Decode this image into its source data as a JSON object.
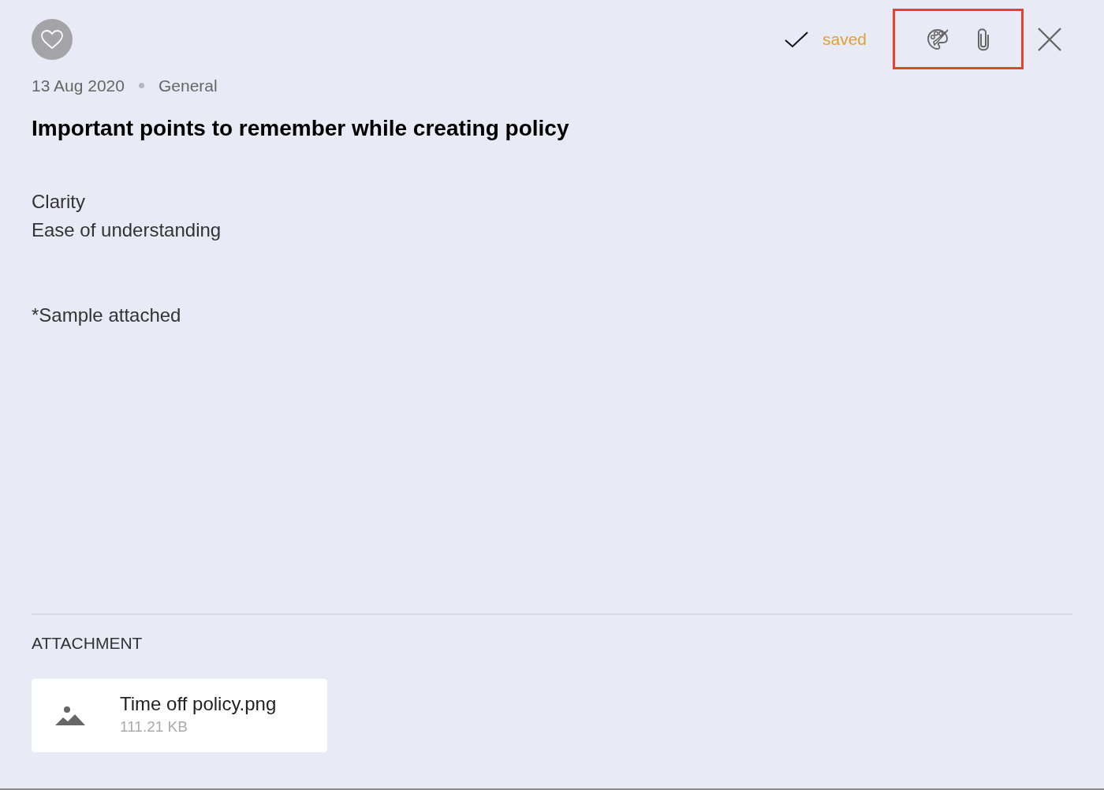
{
  "note": {
    "favorite": false,
    "date": "13 Aug 2020",
    "category": "General",
    "title": "Important points to remember while creating policy",
    "body_blocks": [
      [
        "Clarity",
        "Ease of understanding"
      ],
      [
        "*Sample attached"
      ]
    ]
  },
  "status": {
    "text": "saved",
    "saved": true
  },
  "toolbar": {
    "highlighted": true
  },
  "attachments": {
    "heading": "ATTACHMENT",
    "files": [
      {
        "name": "Time off policy.png",
        "size": "111.21 KB",
        "kind": "image"
      }
    ]
  }
}
